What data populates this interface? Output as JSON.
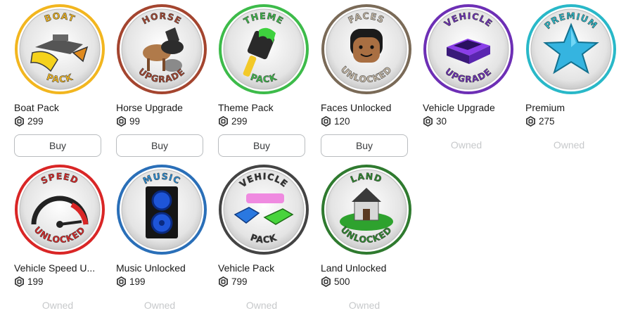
{
  "currency_icon": "robux-icon",
  "items": [
    {
      "name": "Boat Pack",
      "price": "299",
      "action": "Buy",
      "badge_top": "BOAT",
      "badge_bottom": "PACK",
      "icon": "boat-pack-badge-icon",
      "ring": "#f2b61f",
      "title_color": "#f2b61f"
    },
    {
      "name": "Horse Upgrade",
      "price": "99",
      "action": "Buy",
      "badge_top": "HORSE",
      "badge_bottom": "UPGRADE",
      "icon": "horse-upgrade-badge-icon",
      "ring": "#a4452f",
      "title_color": "#a4452f"
    },
    {
      "name": "Theme Pack",
      "price": "299",
      "action": "Buy",
      "badge_top": "THEME",
      "badge_bottom": "PACK",
      "icon": "theme-pack-badge-icon",
      "ring": "#3dbb4a",
      "title_color": "#3dbb4a"
    },
    {
      "name": "Faces Unlocked",
      "price": "120",
      "action": "Buy",
      "badge_top": "FACES",
      "badge_bottom": "UNLOCKED",
      "icon": "faces-unlocked-badge-icon",
      "ring": "#7a6a57",
      "title_color": "#c8bba8"
    },
    {
      "name": "Vehicle Upgrade",
      "price": "30",
      "action": "Owned",
      "badge_top": "VEHICLE",
      "badge_bottom": "UPGRADE",
      "icon": "vehicle-upgrade-badge-icon",
      "ring": "#6d2fb5",
      "title_color": "#6d2fb5"
    },
    {
      "name": "Premium",
      "price": "275",
      "action": "Owned",
      "badge_top": "PREMIUM",
      "badge_bottom": "",
      "icon": "premium-star-badge-icon",
      "ring": "#29b8c8",
      "title_color": "#29b8c8"
    },
    {
      "name": "Vehicle Speed U...",
      "price": "199",
      "action": "Owned",
      "badge_top": "SPEED",
      "badge_bottom": "UNLOCKED",
      "icon": "speedometer-badge-icon",
      "ring": "#d92626",
      "title_color": "#d92626"
    },
    {
      "name": "Music Unlocked",
      "price": "199",
      "action": "Owned",
      "badge_top": "MUSIC",
      "badge_bottom": "",
      "icon": "speaker-badge-icon",
      "ring": "#2a6fb8",
      "title_color": "#2a8fd8"
    },
    {
      "name": "Vehicle Pack",
      "price": "799",
      "action": "Owned",
      "badge_top": "VEHICLE",
      "badge_bottom": "PACK",
      "icon": "vehicle-pack-badge-icon",
      "ring": "#444444",
      "title_color": "#333333"
    },
    {
      "name": "Land Unlocked",
      "price": "500",
      "action": "Owned",
      "badge_top": "LAND",
      "badge_bottom": "UNLOCKED",
      "icon": "house-land-badge-icon",
      "ring": "#2f7a2f",
      "title_color": "#2f8a2f"
    }
  ]
}
